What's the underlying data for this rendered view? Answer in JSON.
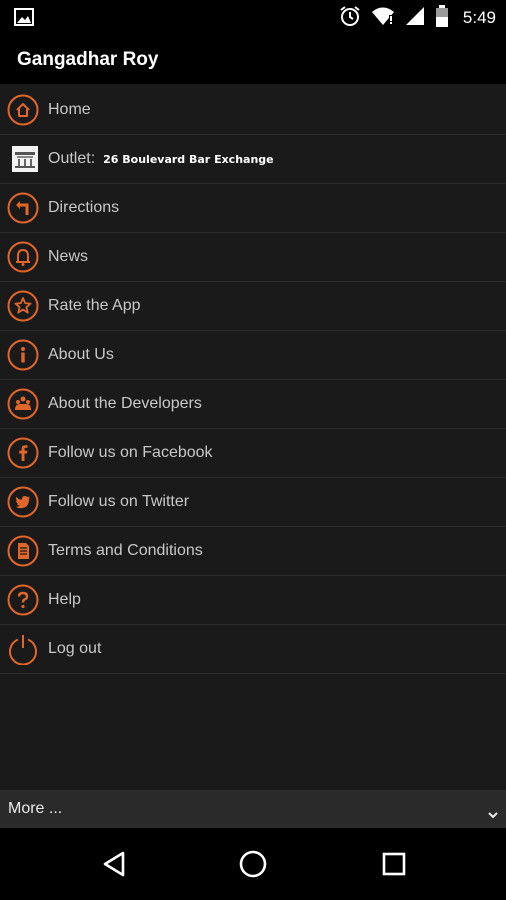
{
  "status_bar": {
    "time": "5:49",
    "icons": [
      "image-notification-icon",
      "alarm-icon",
      "wifi-icon",
      "signal-icon",
      "battery-icon"
    ]
  },
  "header": {
    "title": "Gangadhar Roy"
  },
  "menu": {
    "accent_color": "#e0662a",
    "items": [
      {
        "label": "Home",
        "icon": "home-icon"
      },
      {
        "label": "Outlet:",
        "outlet_name": "26 Boulevard Bar Exchange",
        "icon": "outlet-thumbnail"
      },
      {
        "label": "Directions",
        "icon": "directions-icon"
      },
      {
        "label": "News",
        "icon": "bell-icon"
      },
      {
        "label": "Rate the App",
        "icon": "star-icon"
      },
      {
        "label": "About Us",
        "icon": "info-icon"
      },
      {
        "label": "About the Developers",
        "icon": "developers-icon"
      },
      {
        "label": "Follow us on Facebook",
        "icon": "facebook-icon"
      },
      {
        "label": "Follow us on Twitter",
        "icon": "twitter-icon"
      },
      {
        "label": "Terms and Conditions",
        "icon": "document-icon"
      },
      {
        "label": "Help",
        "icon": "help-icon"
      },
      {
        "label": "Log out",
        "icon": "power-icon"
      }
    ]
  },
  "footer": {
    "more_label": "More ..."
  },
  "nav": {
    "buttons": [
      "back-icon",
      "home-circle-icon",
      "recents-icon"
    ]
  }
}
